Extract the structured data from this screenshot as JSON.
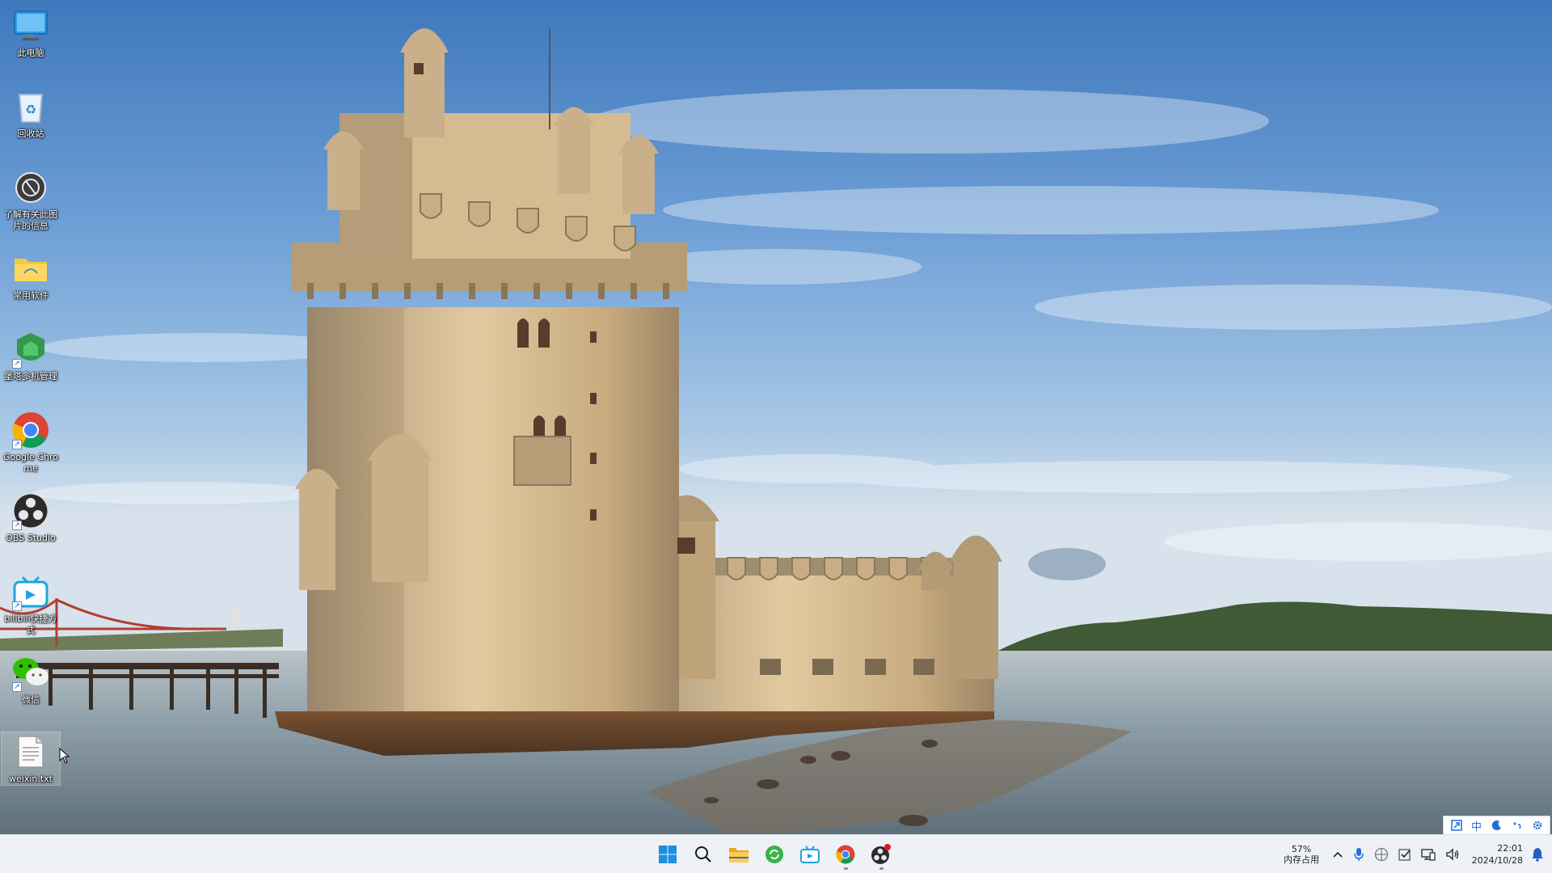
{
  "desktop": {
    "icons": [
      {
        "id": "this-pc",
        "label": "此电脑",
        "icon": "monitor-icon"
      },
      {
        "id": "recycle-bin",
        "label": "回收站",
        "icon": "recycle-bin-icon"
      },
      {
        "id": "learn-about-picture",
        "label": "了解有关此图片的信息",
        "icon": "camera-info-icon"
      },
      {
        "id": "common-software",
        "label": "常用软件",
        "icon": "folder-icon"
      },
      {
        "id": "multi-manager",
        "label": "堡塔多机管理",
        "icon": "green-shield-icon"
      },
      {
        "id": "google-chrome",
        "label": "Google Chrome",
        "icon": "chrome-icon"
      },
      {
        "id": "obs-studio",
        "label": "OBS Studio",
        "icon": "obs-icon"
      },
      {
        "id": "bilibili",
        "label": "bilibili快捷方式",
        "icon": "bilibili-tv-icon"
      },
      {
        "id": "wechat",
        "label": "微信",
        "icon": "wechat-icon"
      },
      {
        "id": "weixin-txt",
        "label": "weixin.txt",
        "icon": "text-file-icon"
      }
    ]
  },
  "ime_toolbar": {
    "mode_label": "中",
    "buttons": [
      "expand-icon",
      "chinese-mode",
      "moon-punctuation-icon",
      "dot-icon",
      "settings-gear-icon"
    ]
  },
  "taskbar": {
    "apps": [
      {
        "id": "start",
        "icon": "windows-start-icon",
        "running": false
      },
      {
        "id": "search",
        "icon": "search-icon",
        "running": false
      },
      {
        "id": "file-explorer",
        "icon": "folder-icon",
        "running": false
      },
      {
        "id": "green-app",
        "icon": "green-refresh-icon",
        "running": false
      },
      {
        "id": "bilibili",
        "icon": "bilibili-tv-icon",
        "running": false
      },
      {
        "id": "chrome",
        "icon": "chrome-icon",
        "running": true
      },
      {
        "id": "obs",
        "icon": "obs-icon",
        "running": true
      }
    ],
    "memory": {
      "percent": "57%",
      "label": "内存占用"
    },
    "tray_icons": [
      "chevron-up-icon",
      "microphone-icon",
      "input-language-icon",
      "checkbox-icon",
      "network-icon",
      "volume-icon"
    ],
    "clock": {
      "time": "22:01",
      "date": "2024/10/28"
    },
    "notification_icon": "bell-icon"
  },
  "colors": {
    "taskbar_bg": "#eef1f6",
    "accent": "#1f6fd6",
    "sky_top": "#4f86c6",
    "sky_mid": "#9dbfe2",
    "water": "#7f97a8",
    "stone": "#c9ab7d"
  }
}
